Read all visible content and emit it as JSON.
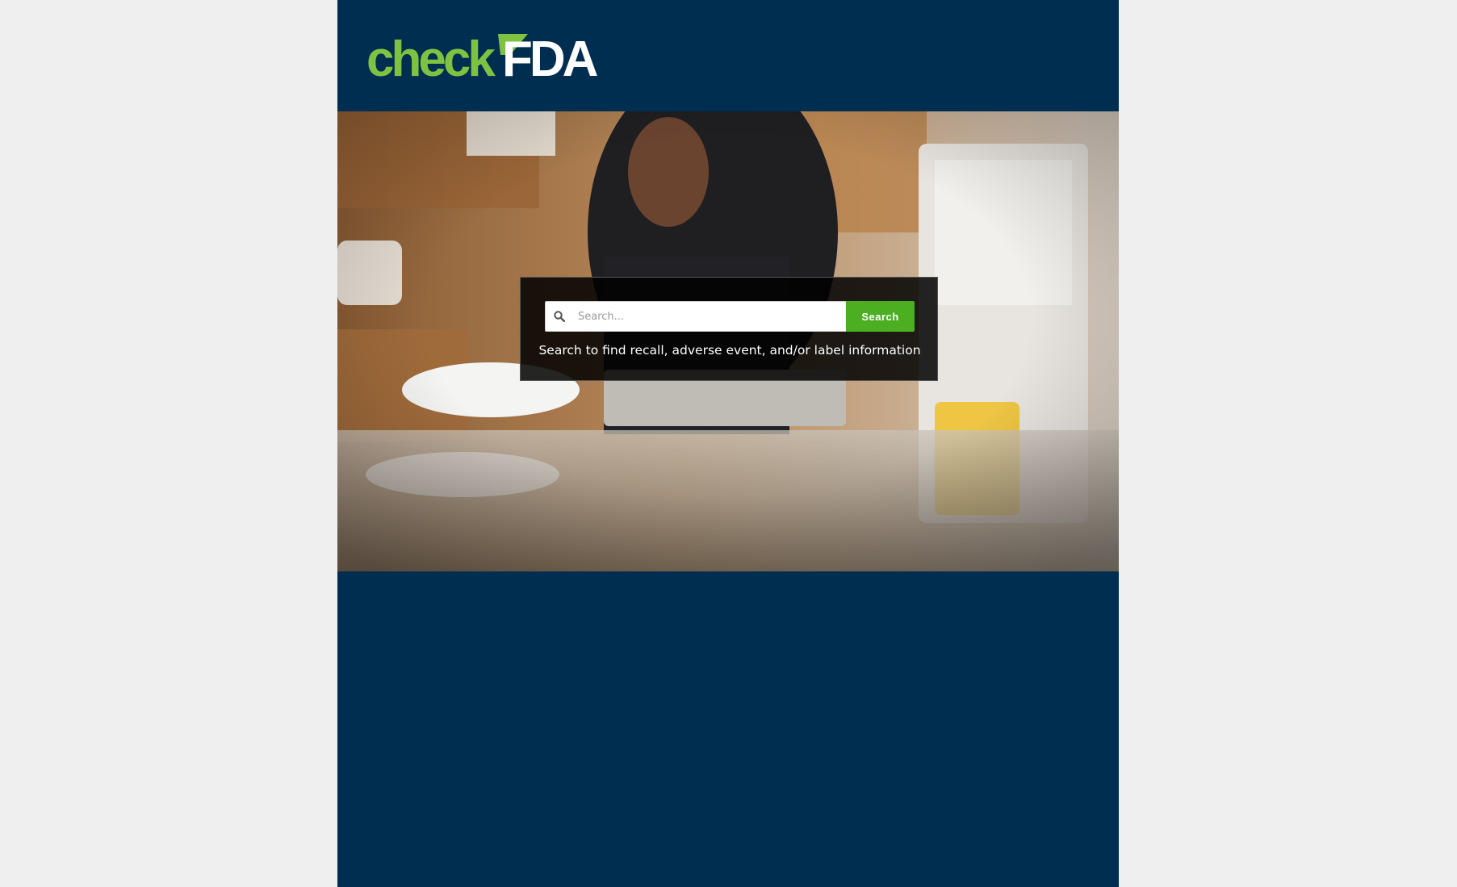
{
  "brand": {
    "logo_check": "check",
    "logo_fda": "FDA",
    "colors": {
      "green": "#7fc242",
      "navy": "#002e51",
      "white": "#ffffff"
    }
  },
  "hero": {
    "image": "man-reading-tablet-in-kitchen",
    "search": {
      "placeholder": "Search...",
      "value": "",
      "button_label": "Search",
      "icon": "search-icon",
      "caption": "Search to find recall, adverse event, and/or label information"
    }
  }
}
